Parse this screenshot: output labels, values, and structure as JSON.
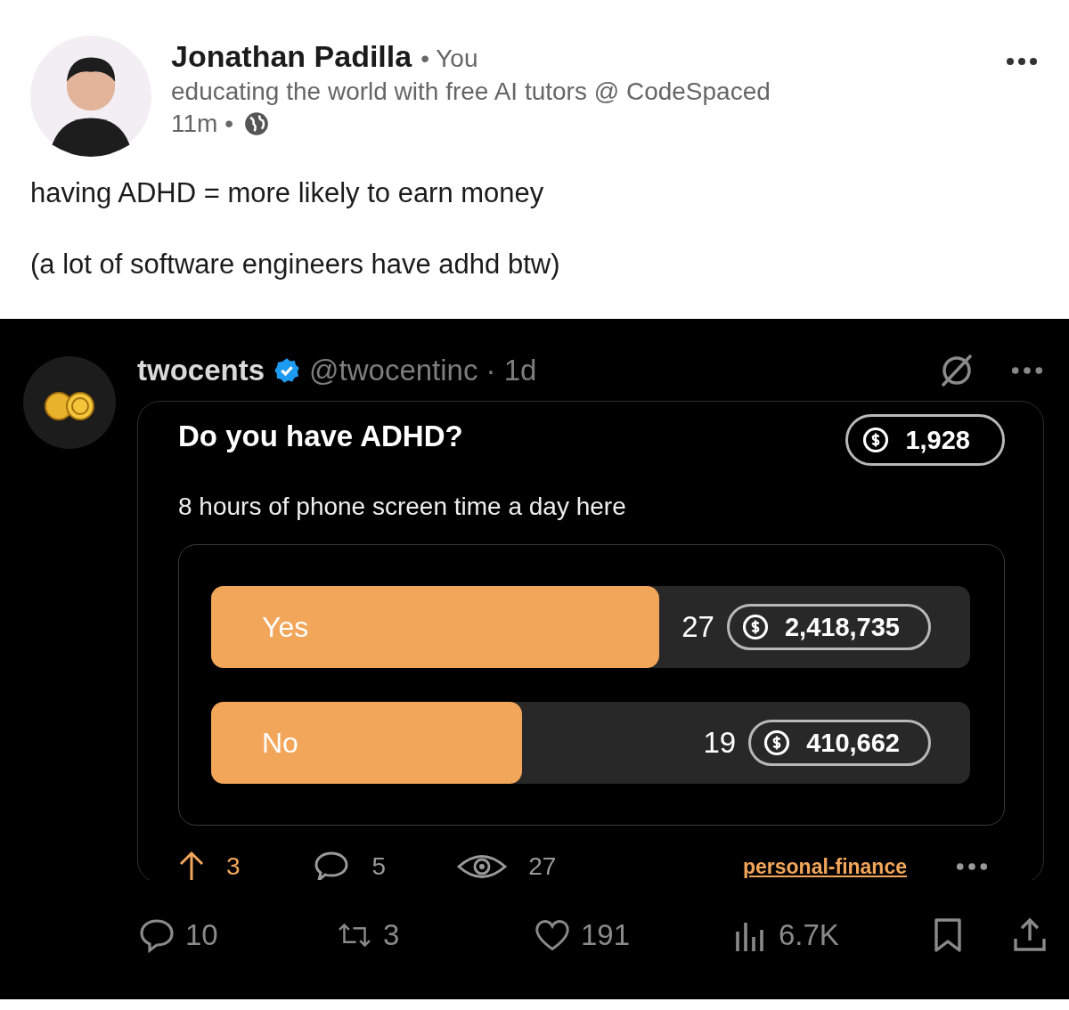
{
  "post": {
    "author": "Jonathan Padilla",
    "relation": "• You",
    "headline": "educating the world with free AI tutors @ CodeSpaced",
    "time": "11m •",
    "paragraphs": [
      "having ADHD = more likely to earn money",
      "(a lot of software engineers have adhd btw)"
    ]
  },
  "tweet": {
    "name": "twocents",
    "verified": true,
    "handle": "@twocentinc · 1d",
    "poll": {
      "title": "Do you have ADHD?",
      "stake": "1,928",
      "description": "8 hours of phone screen time a day here",
      "options": [
        {
          "label": "Yes",
          "count": "27",
          "amount": "2,418,735",
          "level": 0.59
        },
        {
          "label": "No",
          "count": "19",
          "amount": "410,662",
          "level": 0.41
        }
      ],
      "upvotes": "3",
      "comments": "5",
      "views": "27",
      "tag": "personal-finance"
    },
    "actions": {
      "replies": "10",
      "reposts": "3",
      "likes": "191",
      "views": "6.7K"
    }
  }
}
